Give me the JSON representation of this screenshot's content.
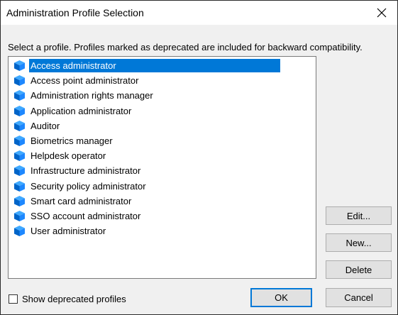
{
  "window": {
    "title": "Administration Profile Selection",
    "close_icon": "close-icon"
  },
  "instruction": "Select a profile.  Profiles marked as deprecated are included for backward compatibility.",
  "profiles": [
    {
      "label": "Access administrator",
      "selected": true
    },
    {
      "label": "Access point administrator"
    },
    {
      "label": "Administration rights manager"
    },
    {
      "label": "Application administrator"
    },
    {
      "label": "Auditor"
    },
    {
      "label": "Biometrics manager"
    },
    {
      "label": "Helpdesk operator"
    },
    {
      "label": "Infrastructure administrator"
    },
    {
      "label": "Security policy administrator"
    },
    {
      "label": "Smart card administrator"
    },
    {
      "label": "SSO account administrator"
    },
    {
      "label": "User administrator"
    }
  ],
  "buttons": {
    "edit": "Edit...",
    "new": "New...",
    "delete": "Delete",
    "ok": "OK",
    "cancel": "Cancel"
  },
  "show_deprecated": {
    "label": "Show deprecated profiles",
    "checked": false
  },
  "colors": {
    "selection": "#0078d7",
    "cube_light": "#3fa9ff",
    "cube_dark": "#0064c8"
  },
  "icons": {
    "profile": "profile-cube-icon"
  }
}
